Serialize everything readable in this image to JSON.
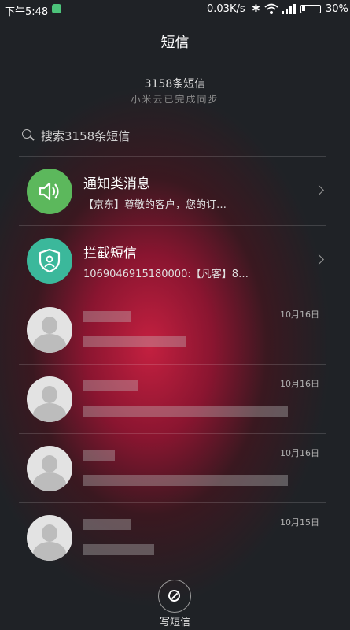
{
  "status_bar": {
    "time": "下午5:48",
    "network_speed": "0.03K/s",
    "battery": "30%"
  },
  "header": {
    "title": "短信",
    "message_count": "3158条短信",
    "sync_status": "小米云已完成同步"
  },
  "search": {
    "placeholder": "搜索3158条短信"
  },
  "conversations": [
    {
      "name": "通知类消息",
      "preview": "【京东】尊敬的客户，您的订…",
      "icon": "speaker-icon",
      "avatar_color": "#5cb85c"
    },
    {
      "name": "拦截短信",
      "preview": "1069046915180000:【凡客】8…",
      "icon": "shield-user-icon",
      "avatar_color": "#3bb89b"
    },
    {
      "date": "10月16日"
    },
    {
      "date": "10月16日"
    },
    {
      "date": "10月16日"
    },
    {
      "date": "10月15日"
    }
  ],
  "compose": {
    "label": "写短信"
  }
}
